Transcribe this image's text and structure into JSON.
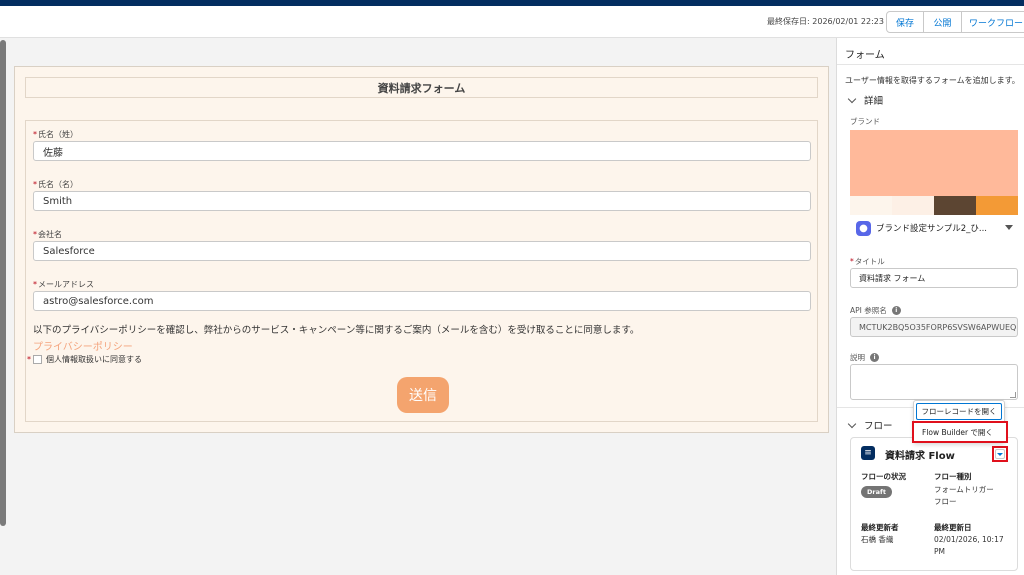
{
  "toolbar": {
    "last_saved": "最終保存日: 2026/02/01 22:23",
    "save_label": "保存",
    "publish_label": "公開",
    "workflow_label": "ワークフロー"
  },
  "form": {
    "title": "資料請求フォーム",
    "fields": [
      {
        "label": "氏名（姓）",
        "value": "佐藤"
      },
      {
        "label": "氏名（名）",
        "value": "Smith"
      },
      {
        "label": "会社名",
        "value": "Salesforce"
      },
      {
        "label": "メールアドレス",
        "value": "astro@salesforce.com"
      }
    ],
    "required_mark": "*",
    "consent_text": "以下のプライバシーポリシーを確認し、弊社からのサービス・キャンペーン等に関するご案内（メールを含む）を受け取ることに同意します。",
    "privacy_link": "プライバシーポリシー",
    "agree_label": "個人情報取扱いに同意する",
    "submit_label": "送信"
  },
  "panel": {
    "header": "フォーム",
    "description": "ユーザー情報を取得するフォームを追加します。",
    "details_section": "詳細",
    "brand_label": "ブランド",
    "brand_colors": {
      "main": "#ffb99a",
      "strip": [
        "#fdf5ec",
        "#fdf0e6",
        "#5c4532",
        "#f39a36"
      ]
    },
    "brand_select": "ブランド設定サンプル2_ひ...",
    "title_label": "タイトル",
    "title_value": "資料請求 フォーム",
    "api_label": "API 参照名",
    "api_value": "MCTUK2BQ5O35FORP6SVSW6APWUEQ",
    "desc_label": "説明",
    "flow_section": "フロー",
    "flow": {
      "name": "資料請求 Flow",
      "status_label": "フローの状況",
      "status_value": "Draft",
      "type_label": "フロー種別",
      "type_value_1": "フォームトリガー",
      "type_value_2": "フロー",
      "updated_by_label": "最終更新者",
      "updated_by_value": "石橋 香織",
      "updated_date_label": "最終更新日",
      "updated_date_1": "02/01/2026, 10:17",
      "updated_date_2": "PM"
    },
    "menu": {
      "open_record": "フローレコードを開く",
      "open_builder": "Flow Builder で開く"
    }
  }
}
